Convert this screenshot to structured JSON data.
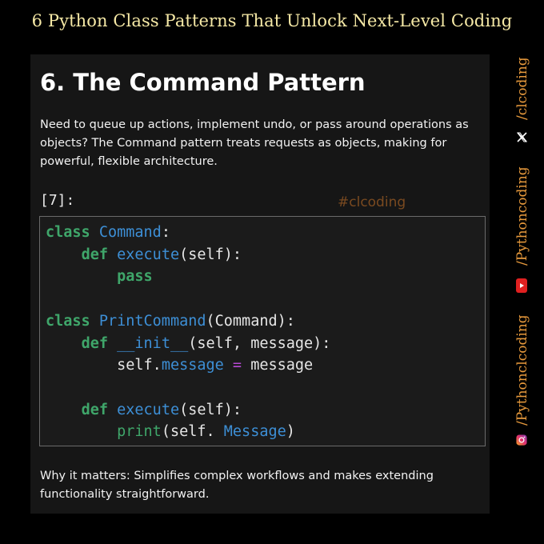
{
  "header": {
    "title": "6 Python Class Patterns That Unlock Next-Level Coding"
  },
  "card": {
    "heading": "6. The Command Pattern",
    "intro": "Need to queue up actions, implement undo, or pass around operations as objects? The Command pattern treats requests as objects, making for powerful, flexible architecture.",
    "prompt": "[7]:",
    "watermark": "#clcoding",
    "why": "Why it matters: Simplifies complex workflows and makes extending functionality straightforward."
  },
  "code": {
    "l1_kw": "class",
    "l1_name": "Command",
    "l1_rest": ":",
    "l2_kw": "def",
    "l2_fn": "execute",
    "l2_rest": "(self):",
    "l3_kw": "pass",
    "l5_kw": "class",
    "l5_name": "PrintCommand",
    "l5_rest": "(Command):",
    "l6_kw": "def",
    "l6_fn": "__init__",
    "l6_rest": "(self, message):",
    "l7_a": "self.",
    "l7_attr": "message",
    "l7_op": "=",
    "l7_b": "message",
    "l9_kw": "def",
    "l9_fn": "execute",
    "l9_rest": "(self):",
    "l10_fn": "print",
    "l10_a": "(self. ",
    "l10_attr": "Message",
    "l10_b": ")"
  },
  "sidebar": {
    "handle_x": "/clcoding",
    "handle_youtube": "/Pythoncoding",
    "handle_instagram": "/Pythonclcoding",
    "icons": [
      "x-icon",
      "youtube-icon",
      "instagram-icon"
    ],
    "accent": "#e89a3c"
  }
}
